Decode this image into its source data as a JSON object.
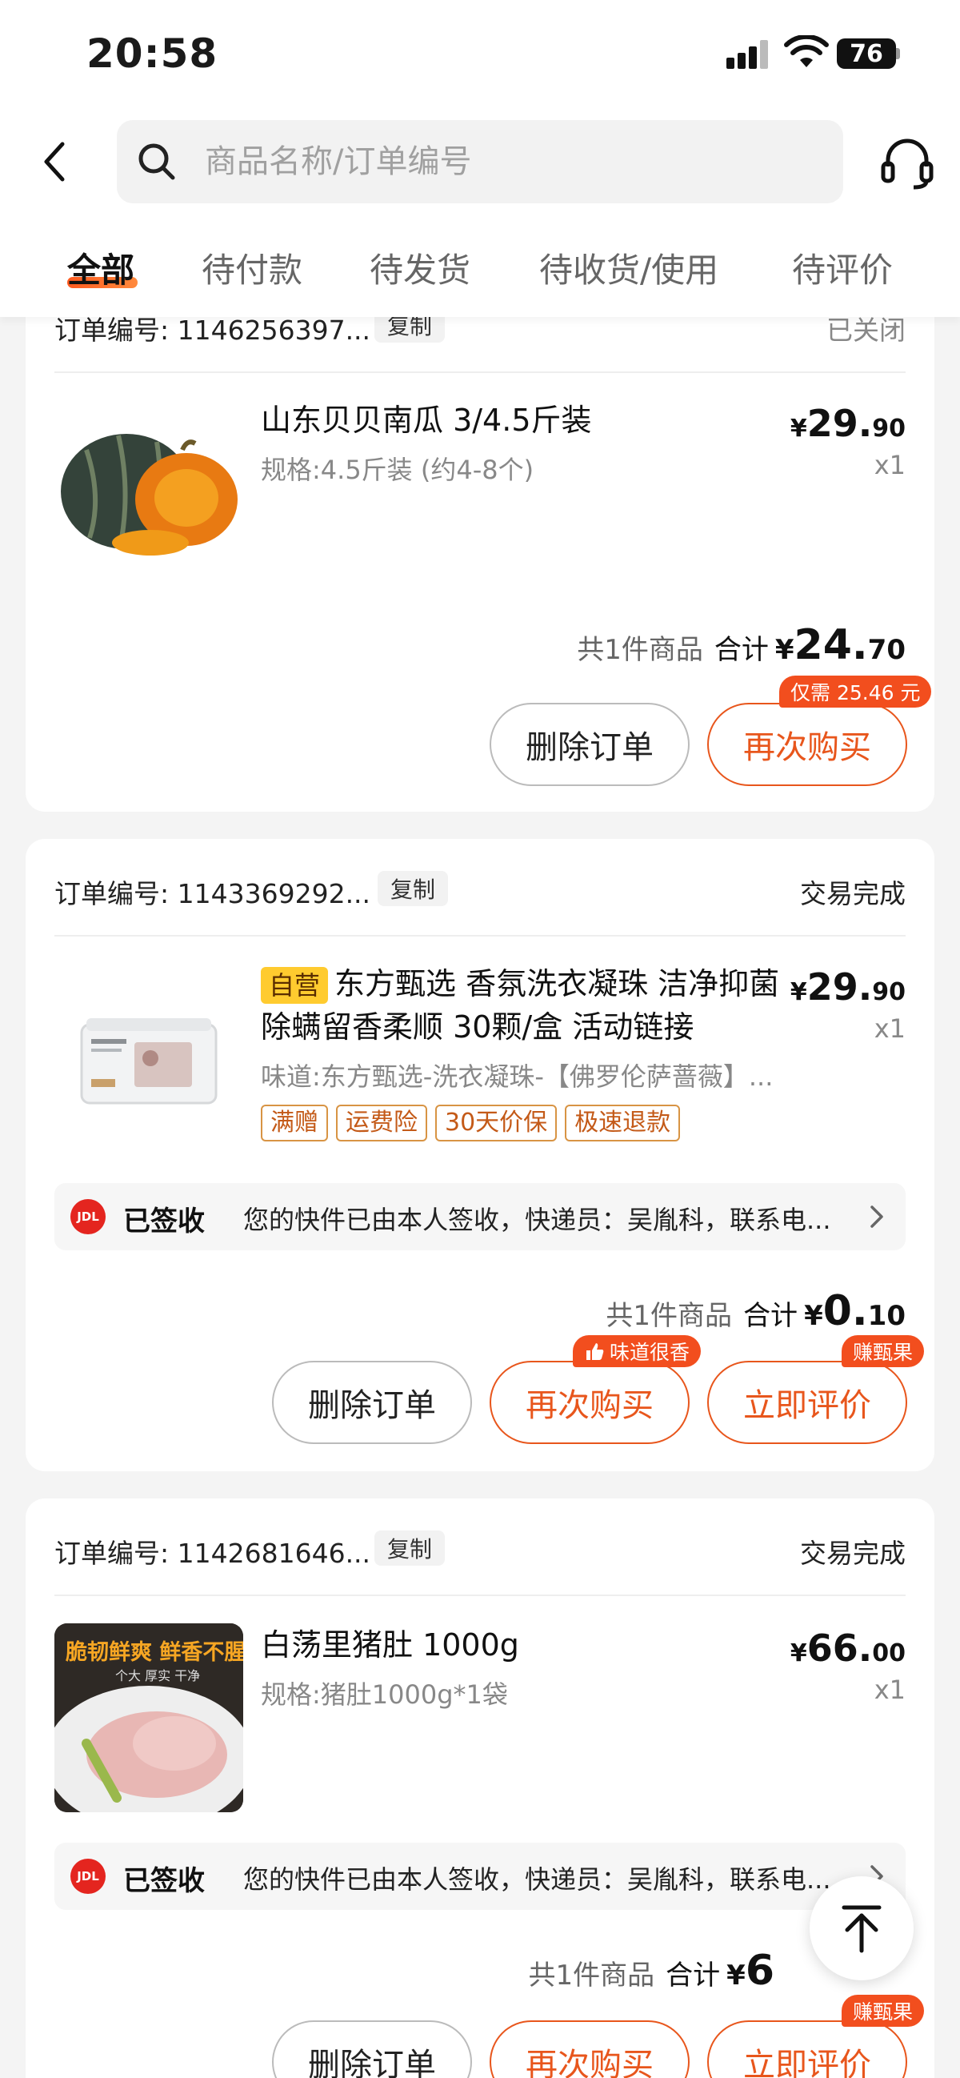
{
  "status_bar": {
    "time": "20:58",
    "battery": "76"
  },
  "search": {
    "placeholder": "商品名称/订单编号"
  },
  "tabs": [
    {
      "label": "全部"
    },
    {
      "label": "待付款"
    },
    {
      "label": "待发货"
    },
    {
      "label": "待收货/使用"
    },
    {
      "label": "待评价"
    }
  ],
  "orders": [
    {
      "order_no": "订单编号: 1146256397...",
      "copy": "复制",
      "status": "已关闭",
      "product_name": "山东贝贝南瓜 3/4.5斤装",
      "spec": "规格:4.5斤装 (约4-8个)",
      "price_symbol": "¥",
      "price_int": "29.",
      "price_dec": "90",
      "qty": "x1",
      "item_count": "共1件商品",
      "total_label": "合计",
      "total_symbol": "¥",
      "total_int": "24.",
      "total_dec": "70",
      "delete_label": "删除订单",
      "rebuy_label": "再次购买",
      "rebuy_bubble": "仅需 25.46 元"
    },
    {
      "order_no": "订单编号: 1143369292...",
      "copy": "复制",
      "status": "交易完成",
      "self_badge": "自营",
      "product_name": "东方甄选 香氛洗衣凝珠 洁净抑菌除螨留香柔顺 30颗/盒 活动链接",
      "spec": "味道:东方甄选-洗衣凝珠-【佛罗伦萨蔷薇】...",
      "tags": [
        "满赠",
        "运费险",
        "30天价保",
        "极速退款"
      ],
      "price_symbol": "¥",
      "price_int": "29.",
      "price_dec": "90",
      "qty": "x1",
      "logistics_status": "已签收",
      "logistics_text": "您的快件已由本人签收，快递员：吴胤科，联系电...",
      "item_count": "共1件商品",
      "total_label": "合计",
      "total_symbol": "¥",
      "total_int": "0.",
      "total_dec": "10",
      "delete_label": "删除订单",
      "rebuy_label": "再次购买",
      "rebuy_bubble": "味道很香",
      "review_label": "立即评价",
      "review_bubble": "赚甄果"
    },
    {
      "order_no": "订单编号: 1142681646...",
      "copy": "复制",
      "status": "交易完成",
      "product_name": "白荡里猪肚 1000g",
      "spec": "规格:猪肚1000g*1袋",
      "thumb_headline": "脆韧鲜爽 鲜香不腥",
      "thumb_sub": "个大 厚实 干净",
      "price_symbol": "¥",
      "price_int": "66.",
      "price_dec": "00",
      "qty": "x1",
      "logistics_status": "已签收",
      "logistics_text": "您的快件已由本人签收，快递员：吴胤科，联系电...",
      "item_count": "共1件商品",
      "total_label": "合计",
      "total_symbol": "¥",
      "total_int": "6",
      "total_dec": "",
      "delete_label": "删除订单",
      "rebuy_label": "再次购买",
      "review_label": "立即评价",
      "review_bubble": "赚甄果"
    }
  ],
  "jdl_logo": "JDL"
}
